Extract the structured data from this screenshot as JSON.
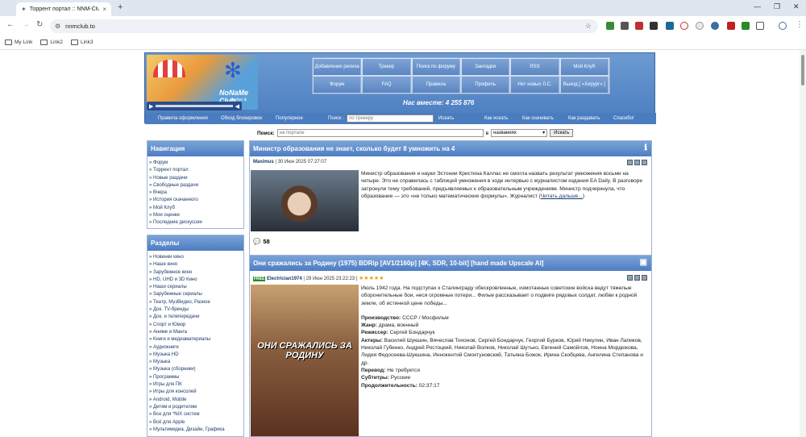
{
  "browser": {
    "tab_title": "Торрент портал :: NNM-Club",
    "url": "nnmclub.to",
    "bookmarks": [
      "My Link",
      "Link2",
      "Link3"
    ]
  },
  "site": {
    "logo_name": "NoNaMe Club",
    "logo_sub": "tracker & forum",
    "menu": [
      "Добавление релиза",
      "Трекер",
      "Поиск по форуму",
      "Закладки",
      "RSS",
      "Мой Клуб",
      "Форум",
      "FAQ",
      "Правила",
      "Профиль",
      "Нет новых Л.С.",
      "Выход [ «Хирург» ]"
    ],
    "counter": "Нас вместе: 4 255 876",
    "sublinks": {
      "rules": "Правила оформления",
      "bypass": "Обход блокировок",
      "popular": "Популярное",
      "search_label": "Поиск :",
      "search_placeholder": "по трекеру",
      "search_btn": "Искать",
      "how_search": "Как искать",
      "how_download": "Как скачивать",
      "how_seed": "Как раздавать",
      "thanks": "Спасибо!"
    },
    "searchbar": {
      "label": "Поиск:",
      "placeholder": "на портале",
      "in": "в",
      "select": "названиях",
      "btn": "Искать"
    }
  },
  "nav": {
    "title": "Навигация",
    "items": [
      "Форум",
      "Торрент портал",
      "Новые раздачи",
      "Свободные раздачи",
      "Вчера",
      "История скачанного",
      "Мой Клуб",
      "Мои оценки",
      "Последние дискуссии"
    ]
  },
  "sections": {
    "title": "Разделы",
    "items": [
      "Новинки кино",
      "Наше кино",
      "Зарубежное кино",
      "HD, UHD и 3D Кино",
      "Наши сериалы",
      "Зарубежные сериалы",
      "Театр, МузВидео, Разное",
      "Док. TV-бренды",
      "Док. и телепередачи",
      "Спорт и Юмор",
      "Аниме и Манга",
      "Книги и медиаматериалы",
      "Аудиокниги",
      "Музыка HD",
      "Музыка",
      "Музыка (сборники)",
      "Программы",
      "Игры для ПК",
      "Игры для консолей",
      "Android, Mobile",
      "Детям и родителям",
      "Все для *NIX систем",
      "Всё для Apple",
      "Мультимедиа, Дизайн, Графика"
    ]
  },
  "post1": {
    "title": "Министр образования не знает, сколько будет 8 умножить на 4",
    "author": "Maximus",
    "date": "| 30 Июн 2025 07:27:07",
    "text": "Министр образования и науки Эстонии Кристина Каллас не смогла назвать результат умножения восьми на четыре. Это не справилась с таблицей умножения в ходе интервью с журналистом издания EA Daily. В разговоре затронули тему требований, предъявляемых к образовательным учреждениям. Министр подчеркнула, что образование — это «не только математические формулы». Журналист (",
    "read_more": "Читать дальше...",
    "text_end": ")",
    "comments": "58"
  },
  "post2": {
    "title": "Они сражались за Родину (1975) BDRip [AV1/2160p] [4K, SDR, 10-bit] [hand made Upscale AI]",
    "free": "FREE",
    "author": "Electrician1974",
    "date": "| 29 Июн 2025 23:22:23 |",
    "stars": "★★★★★",
    "poster_text": "ОНИ СРАЖАЛИСЬ ЗА РОДИНУ",
    "desc": "Июль 1942 года. На подступах к Сталинграду обескровленные, измотанные советские войска ведут тяжелые оборонительные бои, неся огромные потери... Фильм рассказывает о подвиге рядовых солдат, любви к родной земле, об истинной цене победы...",
    "fields": [
      {
        "k": "Производство:",
        "v": "СССР / Мосфильм"
      },
      {
        "k": "Жанр:",
        "v": "драма, военный"
      },
      {
        "k": "Режиссер:",
        "v": "Сергей Бондарчук"
      },
      {
        "k": "Актеры:",
        "v": "Василий Шукшин, Вячеслав Тихонов, Сергей Бондарчук, Георгий Бурков, Юрий Никулин, Иван Лапиков, Николай Губенко, Андрей Ростоцкий, Николай Волков, Николай Шутько, Евгений Самойлов, Нонна Мордюкова, Лидия Федосеева-Шукшина, Иннокентий Смоктуновский, Татьяна Божок, Ирина Скобцева, Ангелина Степанова и др."
      },
      {
        "k": "Перевод:",
        "v": "Не требуется"
      },
      {
        "k": "Субтитры:",
        "v": "Русские"
      },
      {
        "k": "Продолжительность:",
        "v": "02:37:17"
      }
    ]
  }
}
